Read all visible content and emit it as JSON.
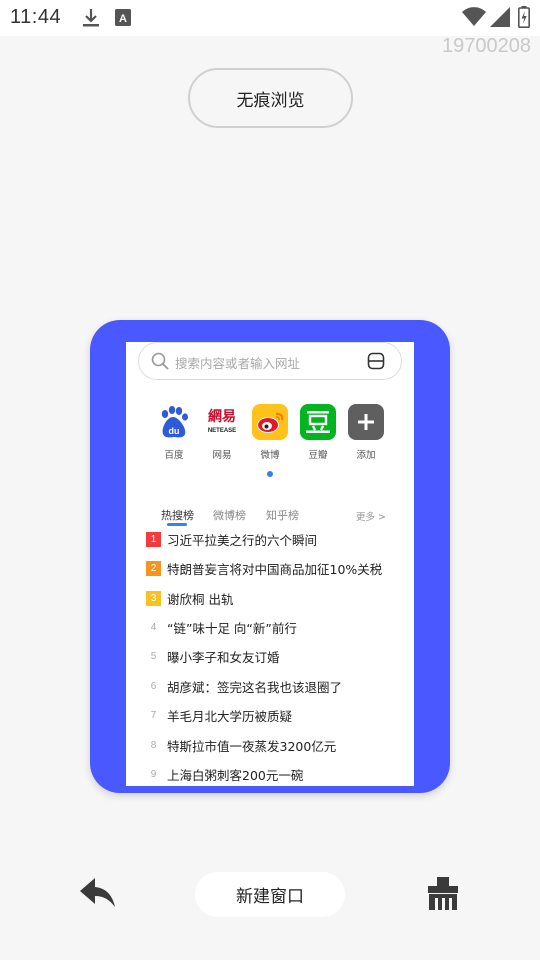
{
  "status_bar": {
    "time": "11:44",
    "icons": [
      "download-icon",
      "keyboard-a-icon",
      "wifi-icon",
      "signal-icon",
      "battery-charging-icon"
    ]
  },
  "date_stamp": "19700208",
  "incognito_button": {
    "label": "无痕浏览"
  },
  "tab_card": {
    "accent_color": "#4a58ff",
    "search": {
      "placeholder": "搜索内容或者输入网址"
    },
    "shortcuts": [
      {
        "label": "百度",
        "icon": "baidu-icon"
      },
      {
        "label": "网易",
        "icon": "netease-icon"
      },
      {
        "label": "微博",
        "icon": "weibo-icon"
      },
      {
        "label": "豆瓣",
        "icon": "douban-icon"
      },
      {
        "label": "添加",
        "icon": "add-icon"
      }
    ],
    "hot_tabs": [
      {
        "label": "热搜榜",
        "active": true
      },
      {
        "label": "微博榜",
        "active": false
      },
      {
        "label": "知乎榜",
        "active": false
      }
    ],
    "more_label": "更多 >",
    "news": [
      {
        "rank": "1",
        "title": "习近平拉美之行的六个瞬间",
        "badge_color": "#f23b3b"
      },
      {
        "rank": "2",
        "title": "特朗普妄言将对中国商品加征10%关税",
        "badge_color": "#f7941d"
      },
      {
        "rank": "3",
        "title": "谢欣桐 出轨",
        "badge_color": "#f7c21d"
      },
      {
        "rank": "4",
        "title": "“链”味十足 向“新”前行"
      },
      {
        "rank": "5",
        "title": "曝小李子和女友订婚"
      },
      {
        "rank": "6",
        "title": "胡彦斌：签完这名我也该退圈了"
      },
      {
        "rank": "7",
        "title": "羊毛月北大学历被质疑"
      },
      {
        "rank": "8",
        "title": "特斯拉市值一夜蒸发3200亿元"
      },
      {
        "rank": "9",
        "title": "上海白粥刺客200元一碗"
      }
    ]
  },
  "toolbar": {
    "new_window_label": "新建窗口",
    "back_icon": "back-arrow-icon",
    "clear_icon": "broom-icon"
  }
}
